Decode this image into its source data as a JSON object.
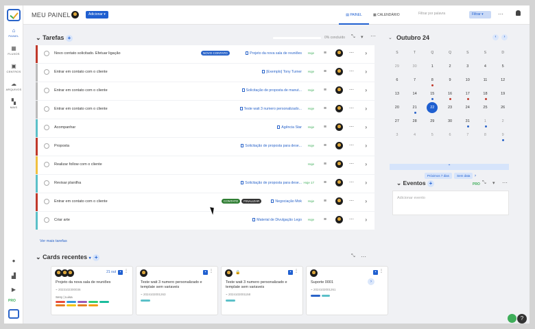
{
  "header": {
    "title": "MEU PAINEL",
    "add_label": "Adicionar",
    "tab_panel": "PAINEL",
    "tab_calendar": "CALENDÁRIO",
    "search_placeholder": "Filtrar por palavra",
    "filter_label": "Filtrar"
  },
  "sidebar": {
    "items": [
      {
        "label": "PAINEL",
        "icon": "home-icon"
      },
      {
        "label": "FLUXOS",
        "icon": "grid-icon"
      },
      {
        "label": "CENTROS",
        "icon": "folder-icon"
      },
      {
        "label": "ARQUIVOS",
        "icon": "cloud-icon"
      },
      {
        "label": "MAIS",
        "icon": "apps-icon"
      }
    ],
    "pro_label": "PRO"
  },
  "tasks": {
    "title": "Tarefas",
    "done_label": "0% concluído",
    "see_more": "Ver mais tarefas",
    "rows": [
      {
        "name": "Novo contato solicitado. Efetuar ligação",
        "tags": [
          {
            "text": "NOVO CONTATO",
            "color": "#2a64c9"
          }
        ],
        "link": "Projeto da nova sala de reuniões",
        "date": "Hoje",
        "color": "#c0392b"
      },
      {
        "name": "Entrar em contato com o cliente",
        "tags": [],
        "link": "[Exemplo] Tony Turner",
        "date": "Hoje",
        "color": "#bbbbbb"
      },
      {
        "name": "Entrar em contato com o cliente",
        "tags": [],
        "link": "Solicitação de proposta de manut...",
        "date": "Hoje",
        "color": "#bbbbbb"
      },
      {
        "name": "Entrar em contato com o cliente",
        "tags": [],
        "link": "Teste wati 3 numero personalizado...",
        "date": "Hoje",
        "color": "#bbbbbb"
      },
      {
        "name": "Acompanhar",
        "tags": [],
        "link": "Agência Star",
        "date": "Hoje",
        "color": "#5bc0c8"
      },
      {
        "name": "Proposta",
        "tags": [],
        "link": "Solicitação de proposta para dese...",
        "date": "Hoje",
        "color": "#c0392b"
      },
      {
        "name": "Realizar follow com o cliente",
        "tags": [],
        "link": "",
        "date": "Hoje",
        "color": "#f0c040"
      },
      {
        "name": "Revisar planilha",
        "tags": [],
        "link": "Solicitação de proposta para dese...",
        "date": "Hoje 17",
        "color": "#5bc0c8"
      },
      {
        "name": "Entrar em contato com o cliente",
        "tags": [
          {
            "text": "CONTATO",
            "color": "#2e7d32"
          },
          {
            "text": "FINALIZAR",
            "color": "#333333"
          }
        ],
        "link": "Negociação Mok",
        "date": "Hoje",
        "color": "#c0392b"
      },
      {
        "name": "Criar arte",
        "tags": [],
        "link": "Material de Divulgação Lego",
        "date": "Hoje",
        "color": "#5bc0c8"
      }
    ]
  },
  "cards": {
    "title": "Cards recentes",
    "items": [
      {
        "title": "Projeto da nova sala de reuniões",
        "code": "2023102300036",
        "date": "21 out",
        "extra": "Seny | Luisa"
      },
      {
        "title": "Teste wati 3 numero personalizado e template sem variaveis",
        "code": "2024102001263",
        "date": "",
        "extra": ""
      },
      {
        "title": "Teste wati 3 numero personalizado e template sem variaveis",
        "code": "2024102001158",
        "date": "",
        "extra": ""
      },
      {
        "title": "Suporte 0001",
        "code": "2024102001261",
        "date": "",
        "extra": ""
      }
    ]
  },
  "calendar": {
    "month": "Outubro 24",
    "dow": [
      "S",
      "T",
      "Q",
      "Q",
      "S",
      "S",
      "D"
    ],
    "weeks": [
      [
        {
          "d": "29",
          "o": true
        },
        {
          "d": "30",
          "o": true
        },
        {
          "d": "1"
        },
        {
          "d": "2"
        },
        {
          "d": "3"
        },
        {
          "d": "4"
        },
        {
          "d": "5"
        }
      ],
      [
        {
          "d": "6"
        },
        {
          "d": "7"
        },
        {
          "d": "8",
          "dot": "#c0392b"
        },
        {
          "d": "9"
        },
        {
          "d": "10"
        },
        {
          "d": "11"
        },
        {
          "d": "12"
        }
      ],
      [
        {
          "d": "13"
        },
        {
          "d": "14"
        },
        {
          "d": "15",
          "dot": "#2a64c9"
        },
        {
          "d": "16",
          "dot": "#c0392b"
        },
        {
          "d": "17",
          "dot": "#c0392b"
        },
        {
          "d": "18",
          "dot": "#c0392b"
        },
        {
          "d": "19"
        }
      ],
      [
        {
          "d": "20"
        },
        {
          "d": "21",
          "dot": "#2a64c9"
        },
        {
          "d": "22",
          "today": true
        },
        {
          "d": "23"
        },
        {
          "d": "24"
        },
        {
          "d": "25"
        },
        {
          "d": "26"
        }
      ],
      [
        {
          "d": "27"
        },
        {
          "d": "28"
        },
        {
          "d": "29"
        },
        {
          "d": "30"
        },
        {
          "d": "31",
          "dot": "#2a64c9"
        },
        {
          "d": "1",
          "o": true,
          "dot": "#2a64c9"
        },
        {
          "d": "2",
          "o": true
        }
      ],
      [
        {
          "d": "3",
          "o": true
        },
        {
          "d": "4",
          "o": true
        },
        {
          "d": "5",
          "o": true
        },
        {
          "d": "6",
          "o": true
        },
        {
          "d": "7",
          "o": true
        },
        {
          "d": "8",
          "o": true
        },
        {
          "d": "9",
          "o": true,
          "dot": "#2a64c9"
        }
      ]
    ],
    "next7": "Próximos 7 dias",
    "no_date": "Sem data"
  },
  "events": {
    "title": "Eventos",
    "placeholder": "Adicionar evento",
    "pro_label": "PRO"
  },
  "colors": {
    "accent": "#1f5fd0",
    "success": "#3fae5a",
    "danger": "#c0392b"
  }
}
